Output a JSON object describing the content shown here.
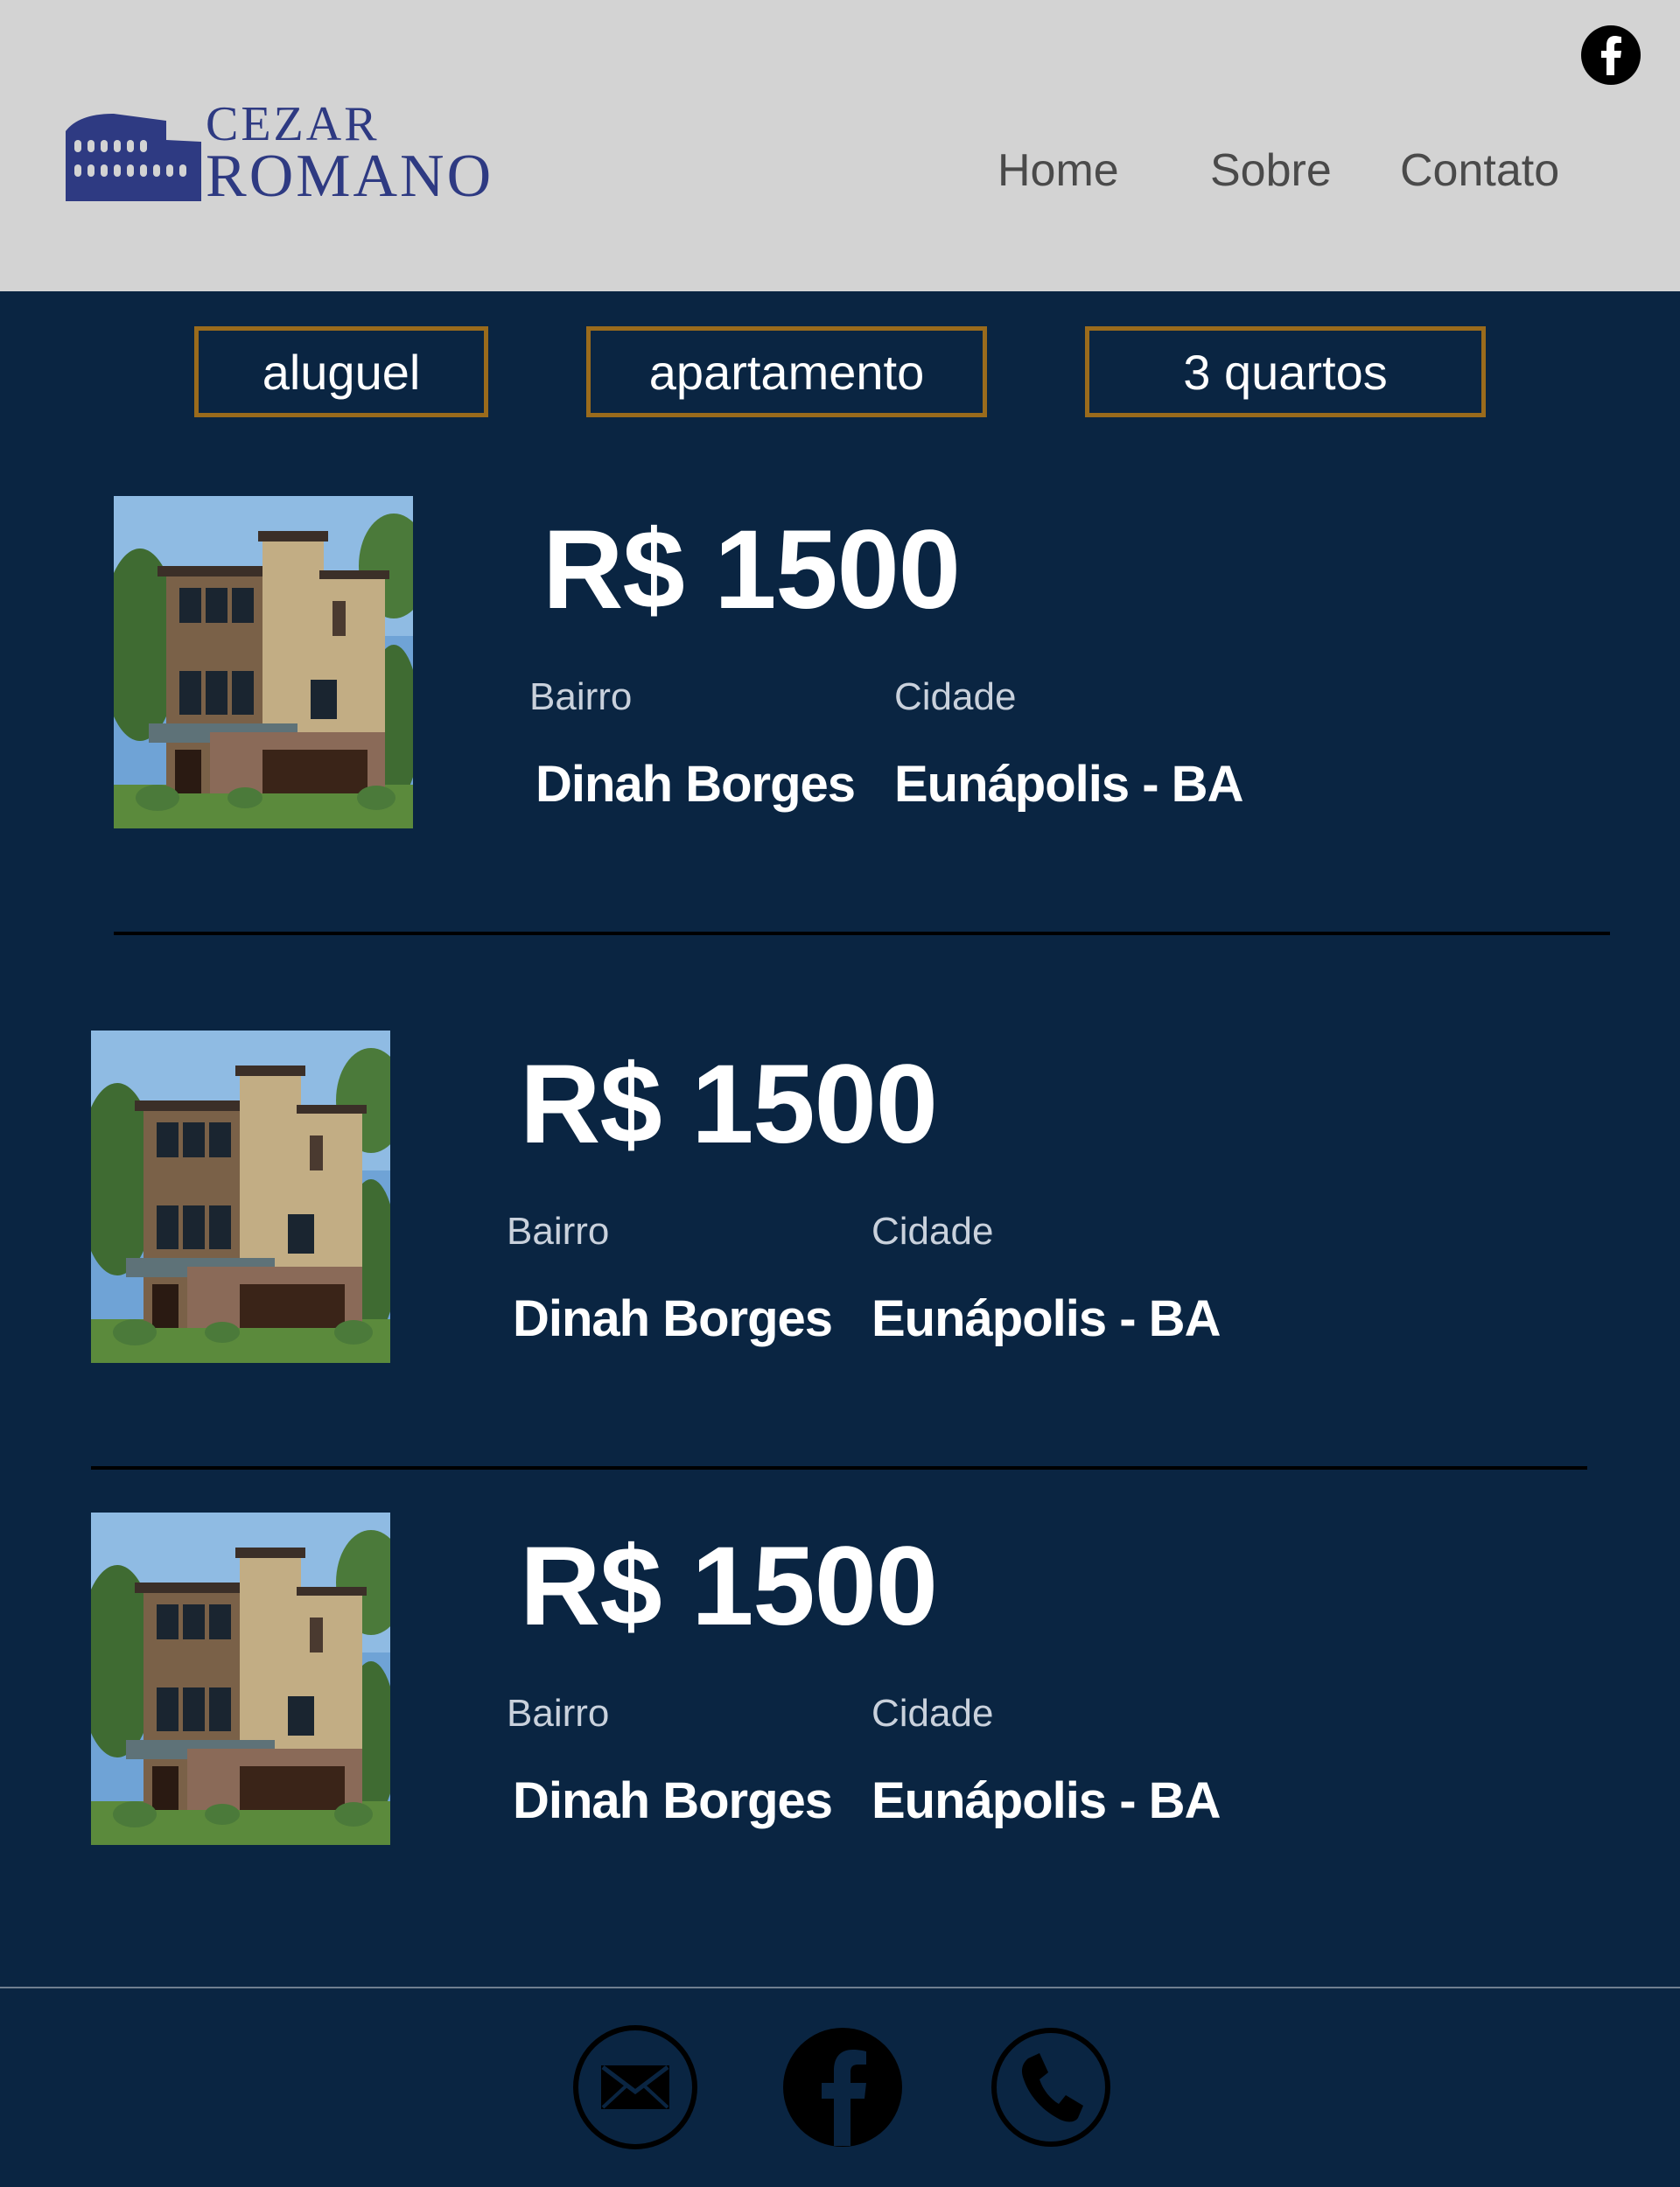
{
  "header": {
    "logo_line1": "CEZAR",
    "logo_line2": "ROMANO",
    "nav": {
      "home": "Home",
      "sobre": "Sobre",
      "contato": "Contato"
    },
    "social_icon": "facebook-icon"
  },
  "filters": {
    "tipo_negocio": "aluguel",
    "tipo_imovel": "apartamento",
    "quartos": "3 quartos"
  },
  "listings": [
    {
      "price": "R$ 1500",
      "bairro_label": "Bairro",
      "bairro": "Dinah Borges",
      "cidade_label": "Cidade",
      "cidade": "Eunápolis - BA"
    },
    {
      "price": "R$ 1500",
      "bairro_label": "Bairro",
      "bairro": "Dinah Borges",
      "cidade_label": "Cidade",
      "cidade": "Eunápolis - BA"
    },
    {
      "price": "R$ 1500",
      "bairro_label": "Bairro",
      "bairro": "Dinah Borges",
      "cidade_label": "Cidade",
      "cidade": "Eunápolis - BA"
    }
  ],
  "footer": {
    "icons": [
      "mail-icon",
      "facebook-icon",
      "phone-icon"
    ]
  },
  "colors": {
    "header_bg": "#d3d3d3",
    "page_bg": "#0a2542",
    "filter_border": "#9a6b1c",
    "logo": "#2e3a82"
  }
}
